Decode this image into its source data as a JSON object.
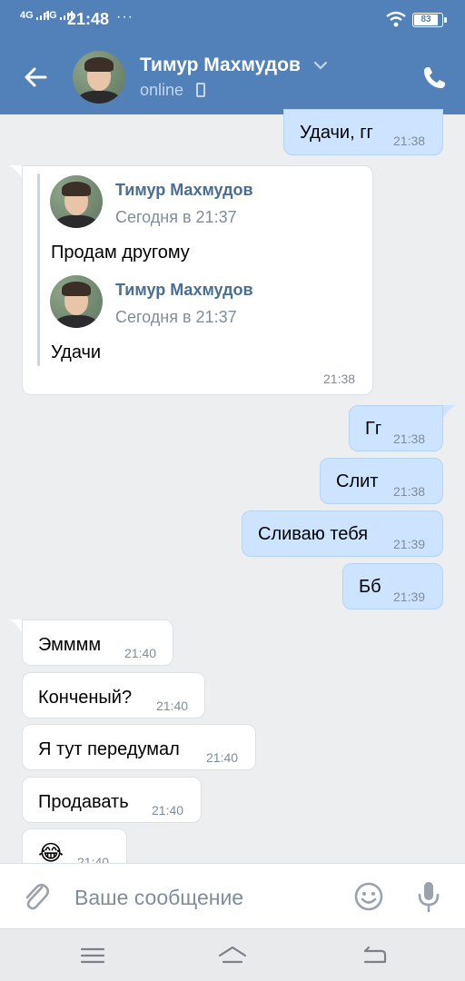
{
  "statusbar": {
    "net1": "4G",
    "net2": "4G",
    "time": "21:48",
    "dots": "···",
    "battery": "83"
  },
  "header": {
    "contact_name": "Тимур Махмудов",
    "status": "online"
  },
  "messages": [
    {
      "dir": "out",
      "text": "Удачи, гг",
      "time": "21:38"
    },
    {
      "dir": "in",
      "type": "forward",
      "time": "21:38",
      "forwarded": [
        {
          "author": "Тимур Махмудов",
          "date": "Сегодня в 21:37",
          "text": "Продам другому"
        },
        {
          "author": "Тимур Махмудов",
          "date": "Сегодня в 21:37",
          "text": "Удачи"
        }
      ]
    },
    {
      "dir": "out",
      "text": "Гг",
      "time": "21:38"
    },
    {
      "dir": "out",
      "text": "Слит",
      "time": "21:38"
    },
    {
      "dir": "out",
      "text": "Сливаю тебя",
      "time": "21:39"
    },
    {
      "dir": "out",
      "text": "Бб",
      "time": "21:39"
    },
    {
      "dir": "in",
      "text": "Эмммм",
      "time": "21:40"
    },
    {
      "dir": "in",
      "text": "Конченый?",
      "time": "21:40"
    },
    {
      "dir": "in",
      "text": "Я тут передумал",
      "time": "21:40"
    },
    {
      "dir": "in",
      "text": "Продавать",
      "time": "21:40"
    },
    {
      "dir": "in",
      "text": "😂",
      "time": "21:40"
    }
  ],
  "composer": {
    "placeholder": "Ваше сообщение"
  },
  "colors": {
    "header_blue": "#5181b8",
    "outgoing_bubble": "#cce4ff",
    "incoming_bubble": "#ffffff",
    "chat_background": "#edeef0",
    "author_link": "#4a6d94"
  },
  "icons": {
    "back": "arrow-left-icon",
    "call": "phone-icon",
    "attach": "paperclip-icon",
    "emoji": "smile-icon",
    "voice": "microphone-icon",
    "nav_menu": "menu-icon",
    "nav_home": "home-icon",
    "nav_back": "back-icon"
  }
}
